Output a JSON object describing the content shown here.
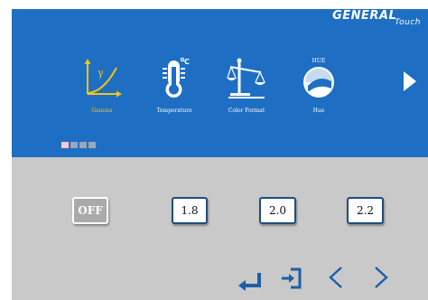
{
  "brand": {
    "logo_main": "GENERAL",
    "logo_sub": "Touch"
  },
  "menu": {
    "items": [
      {
        "label": "Gamma",
        "icon": "gamma-curve-icon",
        "selected": true
      },
      {
        "label": "Temperature",
        "icon": "thermometer-icon",
        "selected": false
      },
      {
        "label": "Color Format",
        "icon": "balance-scale-icon",
        "selected": false
      },
      {
        "label": "Hue",
        "icon": "hue-dial-icon",
        "icon_text": "HUE",
        "selected": false
      }
    ],
    "next_icon": "right-triangle-arrow-icon"
  },
  "pager": {
    "pages": 4,
    "current": 1
  },
  "options": [
    {
      "label": "OFF",
      "selected": true
    },
    {
      "label": "1.8",
      "selected": false
    },
    {
      "label": "2.0",
      "selected": false
    },
    {
      "label": "2.2",
      "selected": false
    }
  ],
  "nav": {
    "enter_icon": "enter-icon",
    "exit_icon": "exit-icon",
    "prev_icon": "chevron-left-icon",
    "next_icon": "chevron-right-icon"
  },
  "colors": {
    "header_bg": "#1e6fc3",
    "panel_bg": "#c9c9c9",
    "selected_label": "#f2c418",
    "active_dot": "#f7c8d3",
    "inactive_dot": "#9aa7b6",
    "button_border": "#1f4d84"
  }
}
